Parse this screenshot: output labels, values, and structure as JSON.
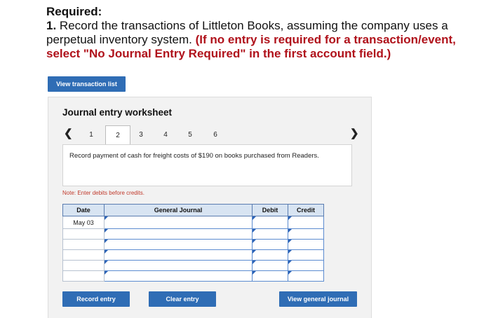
{
  "required": {
    "title": "Required:",
    "number": "1.",
    "instruction": "Record the transactions of Littleton Books, assuming the company uses a perpetual inventory system.",
    "emphasis": "(If no entry is required for a transaction/event, select \"No Journal Entry Required\" in the first account field.)"
  },
  "view_transaction_list_label": "View transaction list",
  "worksheet": {
    "title": "Journal entry worksheet",
    "tabs": [
      "1",
      "2",
      "3",
      "4",
      "5",
      "6"
    ],
    "active_tab": "2",
    "description": "Record payment of cash for freight costs of $190 on books purchased from Readers.",
    "note": "Note: Enter debits before credits.",
    "table": {
      "headers": [
        "Date",
        "General Journal",
        "Debit",
        "Credit"
      ],
      "rows": [
        {
          "date": "May 03",
          "account": "",
          "debit": "",
          "credit": ""
        },
        {
          "date": "",
          "account": "",
          "debit": "",
          "credit": ""
        },
        {
          "date": "",
          "account": "",
          "debit": "",
          "credit": ""
        },
        {
          "date": "",
          "account": "",
          "debit": "",
          "credit": ""
        },
        {
          "date": "",
          "account": "",
          "debit": "",
          "credit": ""
        },
        {
          "date": "",
          "account": "",
          "debit": "",
          "credit": ""
        }
      ]
    },
    "buttons": {
      "record": "Record entry",
      "clear": "Clear entry",
      "view_general_journal": "View general journal"
    }
  },
  "colors": {
    "button_blue": "#2f6db5",
    "instruction_red": "#b0121b",
    "header_bg": "#d8e4f2"
  }
}
